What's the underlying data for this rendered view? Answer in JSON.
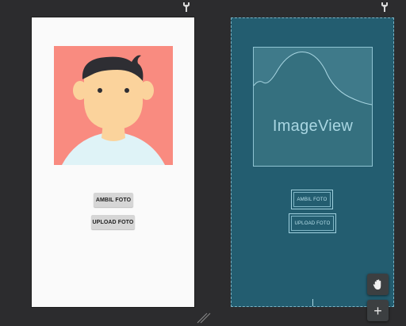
{
  "toolbar": {
    "left_icon": "wrench-icon",
    "right_icon": "wrench-icon"
  },
  "design": {
    "image_icon": "avatar-illustration",
    "buttons": {
      "ambil_label": "AMBIL FOTO",
      "upload_label": "UPLOAD FOTO"
    }
  },
  "blueprint": {
    "image_label": "ImageView",
    "buttons": {
      "ambil_label": "AMBIL FOTO",
      "upload_label": "UPLOAD FOTO"
    }
  },
  "tools": {
    "pan_icon": "hand-icon",
    "zoom_label": "+"
  },
  "colors": {
    "canvas_bg": "#2c2c2e",
    "design_bg": "#fafafa",
    "avatar_bg": "#f98b80",
    "blueprint_bg": "#235d70",
    "blueprint_line": "#8fc3d2"
  }
}
